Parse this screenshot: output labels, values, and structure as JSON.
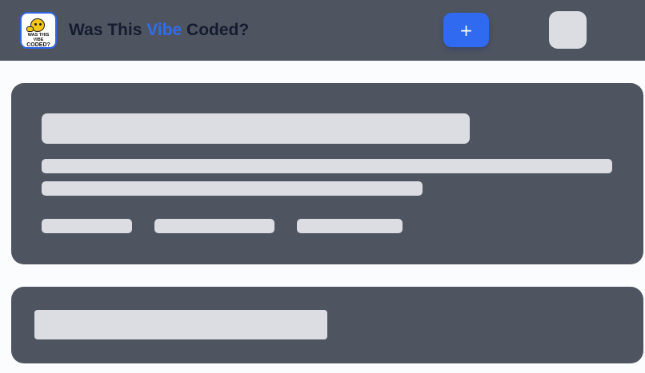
{
  "header": {
    "logo": {
      "line1": "WAS THIS VIBE",
      "line2": "CODED?",
      "icon": "thinking-face-icon"
    },
    "title": {
      "part1": "Was This ",
      "accent": "Vibe",
      "part2": " Coded?"
    },
    "add_button": {
      "label": "+",
      "icon": "plus-icon"
    }
  },
  "colors": {
    "header_bg": "#4f5560",
    "accent": "#2f6df0",
    "skeleton": "#dcdde3",
    "page_bg": "#fbfcfd"
  },
  "state": "loading-skeleton"
}
